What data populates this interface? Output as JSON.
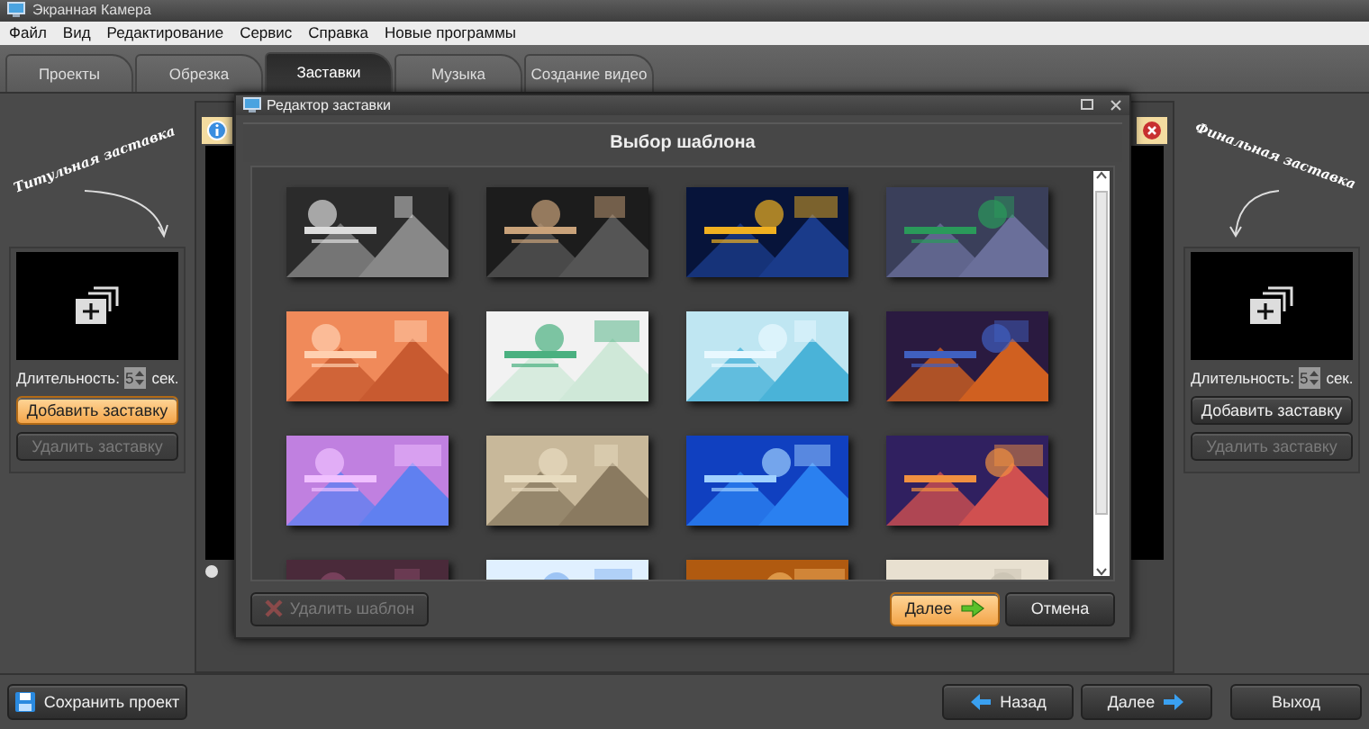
{
  "window": {
    "title": "Экранная Камера"
  },
  "menu": [
    "Файл",
    "Вид",
    "Редактирование",
    "Сервис",
    "Справка",
    "Новые программы"
  ],
  "tabs": [
    {
      "label": "Проекты",
      "selected": false
    },
    {
      "label": "Обрезка",
      "selected": false
    },
    {
      "label": "Заставки",
      "selected": true
    },
    {
      "label": "Музыка",
      "selected": false
    },
    {
      "label": "Создание видео",
      "selected": false
    }
  ],
  "side_panels": [
    {
      "heading": "Титульная заставка",
      "duration_label": "Длительность:",
      "duration": "5",
      "unit": "сек.",
      "add_button": "Добавить заставку",
      "add_highlighted": true,
      "remove_button": "Удалить заставку",
      "remove_disabled": true
    },
    {
      "heading": "Финальная заставка",
      "duration_label": "Длительность:",
      "duration": "5",
      "unit": "сек.",
      "add_button": "Добавить заставку",
      "add_highlighted": false,
      "remove_button": "Удалить заставку",
      "remove_disabled": true
    }
  ],
  "dialog": {
    "title": "Редактор заставки",
    "heading": "Выбор шаблона",
    "delete_button": "Удалить шаблон",
    "delete_disabled": true,
    "next_button": "Далее",
    "cancel_button": "Отмена"
  },
  "bottom": {
    "save_button": "Сохранить проект",
    "back_button": "Назад",
    "next_button": "Далее",
    "exit_button": "Выход"
  }
}
